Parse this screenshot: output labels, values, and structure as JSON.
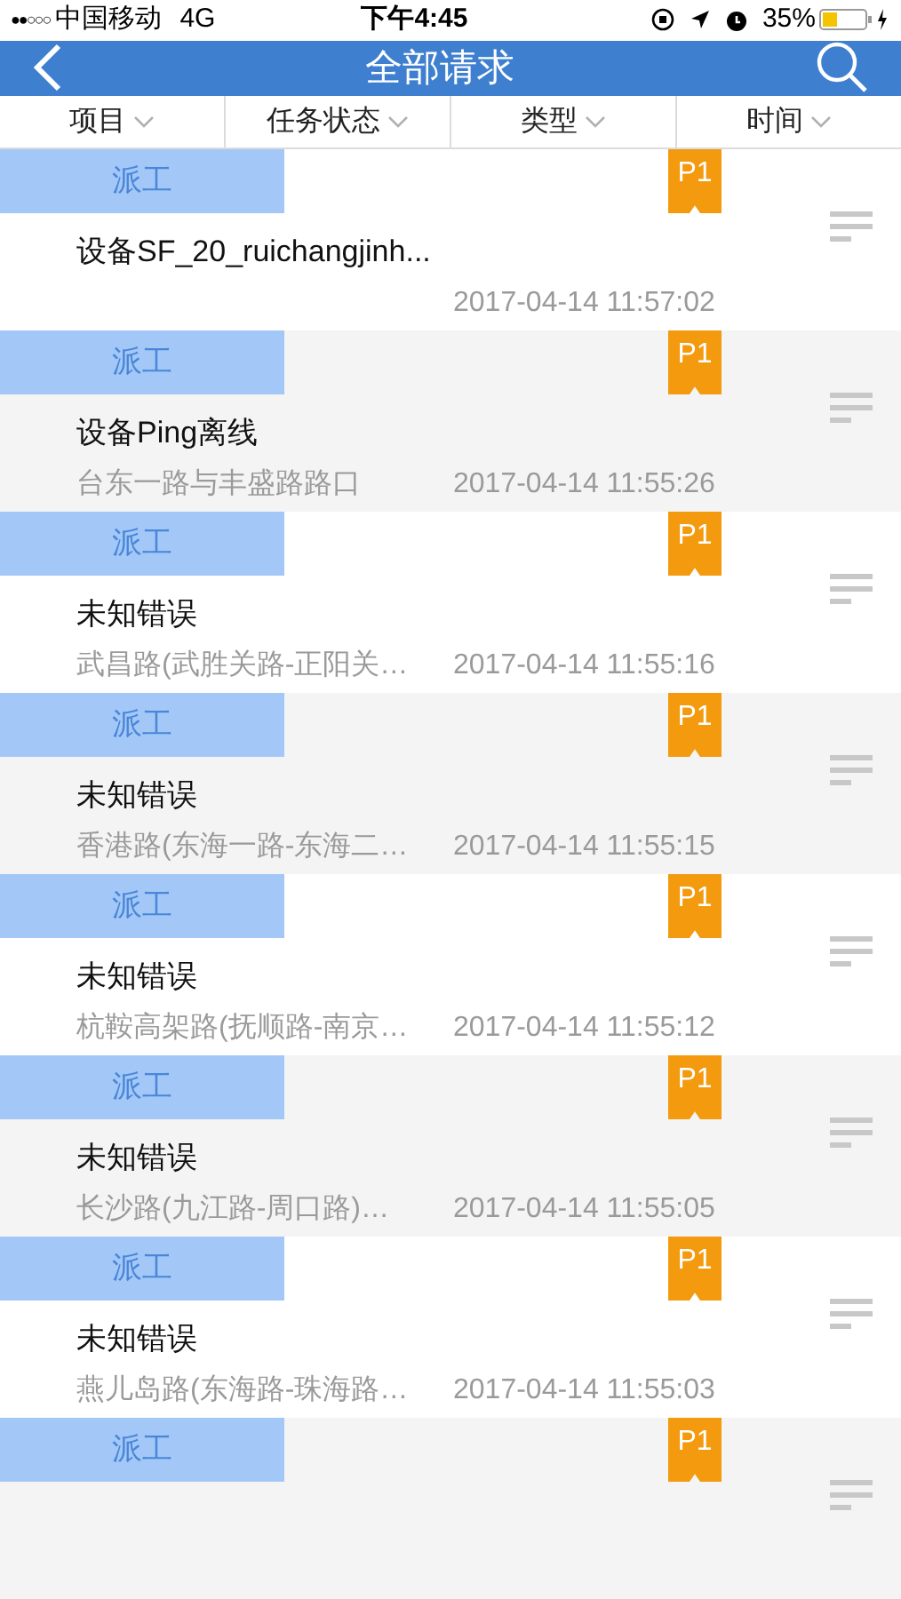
{
  "status_bar": {
    "signal": "●●○○○",
    "carrier": "中国移动",
    "network": "4G",
    "time": "下午4:45",
    "battery": "35%"
  },
  "nav": {
    "title": "全部请求"
  },
  "filters": [
    {
      "label": "项目"
    },
    {
      "label": "任务状态"
    },
    {
      "label": "类型"
    },
    {
      "label": "时间"
    }
  ],
  "requests": [
    {
      "tag": "派工",
      "priority": "P1",
      "title": "设备SF_20_ruichangjinh...",
      "time": "2017-04-14 11:57:02"
    },
    {
      "tag": "派工",
      "priority": "P1",
      "title": "设备Ping离线",
      "address": "台东一路与丰盛路路口",
      "time": "2017-04-14 11:55:26"
    },
    {
      "tag": "派工",
      "priority": "P1",
      "title": "未知错误",
      "address": "武昌路(武胜关路-正阳关…",
      "time": "2017-04-14 11:55:16"
    },
    {
      "tag": "派工",
      "priority": "P1",
      "title": "未知错误",
      "address": "香港路(东海一路-东海二…",
      "time": "2017-04-14 11:55:15"
    },
    {
      "tag": "派工",
      "priority": "P1",
      "title": "未知错误",
      "address": "杭鞍高架路(抚顺路-南京…",
      "time": "2017-04-14 11:55:12"
    },
    {
      "tag": "派工",
      "priority": "P1",
      "title": "未知错误",
      "address": "长沙路(九江路-周口路)…",
      "time": "2017-04-14 11:55:05"
    },
    {
      "tag": "派工",
      "priority": "P1",
      "title": "未知错误",
      "address": "燕儿岛路(东海路-珠海路…",
      "time": "2017-04-14 11:55:03"
    },
    {
      "tag": "派工",
      "priority": "P1"
    }
  ]
}
